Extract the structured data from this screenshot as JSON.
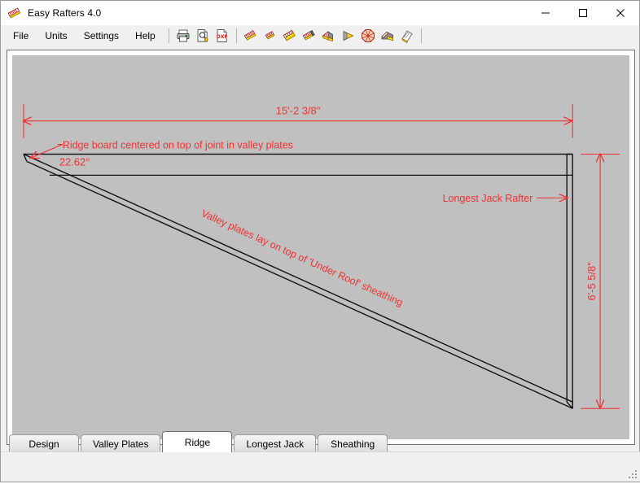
{
  "window": {
    "title": "Easy Rafters 4.0",
    "app_icon": "rafter-icon",
    "controls": [
      {
        "name": "minimize-button",
        "icon": "minimize-icon",
        "label": "—"
      },
      {
        "name": "maximize-button",
        "icon": "maximize-icon",
        "label": "□"
      },
      {
        "name": "close-button",
        "icon": "close-icon",
        "label": "✕"
      }
    ]
  },
  "menu": {
    "items": [
      {
        "label": "File",
        "name": "menu-file"
      },
      {
        "label": "Units",
        "name": "menu-units"
      },
      {
        "label": "Settings",
        "name": "menu-settings"
      },
      {
        "label": "Help",
        "name": "menu-help"
      }
    ]
  },
  "toolbar": {
    "buttons": [
      {
        "name": "print-button",
        "icon": "printer-icon",
        "tooltip": "Print"
      },
      {
        "name": "print-preview-button",
        "icon": "print-preview-icon",
        "tooltip": "Print Preview"
      },
      {
        "name": "export-dxf-button",
        "icon": "dxf-file-icon",
        "tooltip": "DXF",
        "label": "DXF"
      },
      {
        "name": "rafter-tool-1-button",
        "icon": "rafter-red-icon",
        "tooltip": "Rafter"
      },
      {
        "name": "rafter-tool-2-button",
        "icon": "rafter-small-icon",
        "tooltip": "Rafter"
      },
      {
        "name": "rafter-tool-3-button",
        "icon": "rafter-yellow-icon",
        "tooltip": "Rafter"
      },
      {
        "name": "rafter-tool-4-button",
        "icon": "rafter-dark-icon",
        "tooltip": "Rafter"
      },
      {
        "name": "hip-valley-button",
        "icon": "hip-valley-icon",
        "tooltip": "Hip / Valley"
      },
      {
        "name": "wedge-button",
        "icon": "yellow-wedge-icon",
        "tooltip": "Wedge"
      },
      {
        "name": "octagon-button",
        "icon": "octagon-roof-icon",
        "tooltip": "Octagon Roof"
      },
      {
        "name": "dormer-button",
        "icon": "dormer-icon",
        "tooltip": "Dormer"
      },
      {
        "name": "sheathing-button",
        "icon": "sheathing-icon",
        "tooltip": "Sheathing"
      }
    ]
  },
  "drawing": {
    "annotations": {
      "top_dimension": "15'-2 3/8\"",
      "right_dimension": "6'-5 5/8\"",
      "angle": "22.62°",
      "ridge_note": "Ridge board centered on top of joint in valley plates",
      "jack_rafter_note": "Longest Jack Rafter",
      "valley_note": "Valley plates lay on top of 'Under Roof' sheathing"
    },
    "colors": {
      "annotation": "#ee3333",
      "geometry": "#000000",
      "surface": "#c0c0c0"
    }
  },
  "tabs": {
    "items": [
      {
        "label": "Design",
        "name": "tab-design",
        "active": false
      },
      {
        "label": "Valley Plates",
        "name": "tab-valley-plates",
        "active": false
      },
      {
        "label": "Ridge",
        "name": "tab-ridge",
        "active": true
      },
      {
        "label": "Longest Jack",
        "name": "tab-longest-jack",
        "active": false
      },
      {
        "label": "Sheathing",
        "name": "tab-sheathing",
        "active": false
      }
    ]
  }
}
